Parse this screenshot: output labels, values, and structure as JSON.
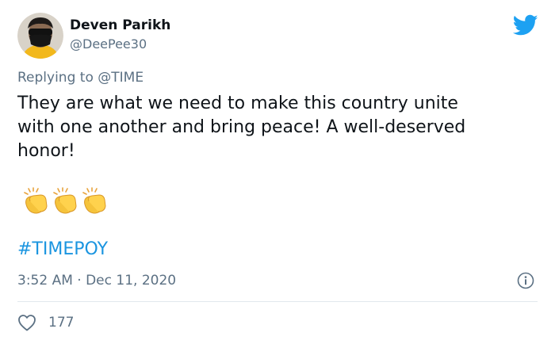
{
  "author": {
    "display_name": "Deven Parikh",
    "handle": "@DeePee30",
    "avatar_icon": "person-with-face-mask-avatar"
  },
  "reply": {
    "prefix": "Replying to",
    "mention": "@TIME"
  },
  "body": {
    "lines": [
      "They are what we need to make this country unite",
      "with one another and bring peace! A well-deserved",
      "honor!"
    ],
    "emoji": [
      "👏",
      "👏",
      "👏"
    ]
  },
  "hashtag": "#TIMEPOY",
  "timestamp": "3:52 AM · Dec 11, 2020",
  "likes": {
    "count": "177",
    "icon": "heart-icon"
  },
  "brand": {
    "icon": "twitter-bird-icon",
    "color": "#1da1f2",
    "link_color": "#1b95e0",
    "muted_color": "#5b7083"
  }
}
